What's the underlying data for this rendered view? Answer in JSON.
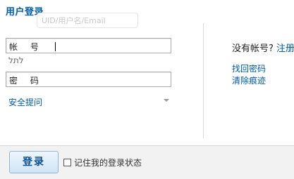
{
  "header": {
    "title": "用户登录",
    "tooltip_text": "UID/用户名/Email"
  },
  "form": {
    "account_label": "帐 号",
    "password_label": "密 码",
    "small_icon_text": "לתל",
    "security_question_label": "安全提问"
  },
  "side": {
    "no_account_text": "没有帐号?",
    "register_link": "注册",
    "recover_password": "找回密码",
    "clear_traces": "清除痕迹"
  },
  "footer": {
    "login_button": "登录",
    "remember_label": "记住我的登录状态"
  }
}
